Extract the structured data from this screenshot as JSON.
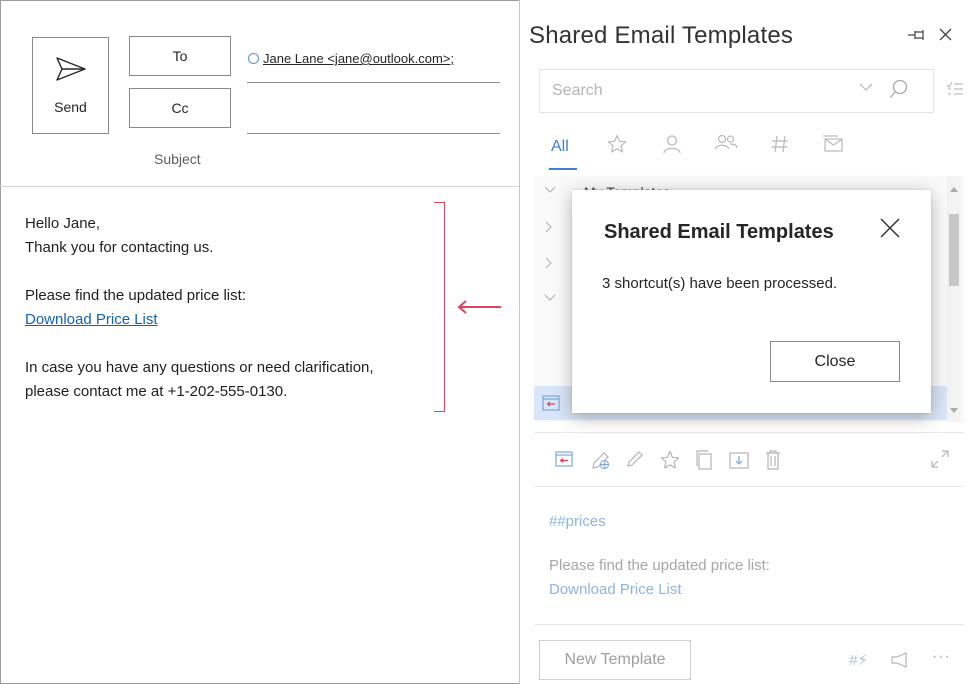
{
  "compose": {
    "send_label": "Send",
    "to_label": "To",
    "cc_label": "Cc",
    "recipient": "Jane Lane <jane@outlook.com>;",
    "subject_label": "Subject",
    "body": {
      "greeting": "Hello Jane,",
      "line2": "Thank you for contacting us.",
      "line3": "Please find the updated price list:",
      "link": "Download Price List",
      "line5": "In case you have any questions or need clarification,",
      "line6": "please contact me at +1-202-555-0130."
    },
    "accent_color": "#e0445a"
  },
  "addin": {
    "title": "Shared Email Templates",
    "search": {
      "placeholder": "Search"
    },
    "tabs": [
      {
        "label": "All",
        "active": true
      },
      {
        "icon": "star-icon"
      },
      {
        "icon": "person-icon"
      },
      {
        "icon": "people-icon"
      },
      {
        "icon": "hashtag-icon"
      },
      {
        "icon": "shared-mail-icon"
      }
    ],
    "tree": {
      "partial_label": "My Templates"
    },
    "preview": {
      "shortcut": "##prices",
      "line1": "Please find the updated price list:",
      "link": "Download Price List"
    },
    "new_template_label": "New Template",
    "accent_color": "#3d7fd2"
  },
  "dialog": {
    "title": "Shared Email Templates",
    "message": "3 shortcut(s) have been processed.",
    "close_label": "Close"
  }
}
